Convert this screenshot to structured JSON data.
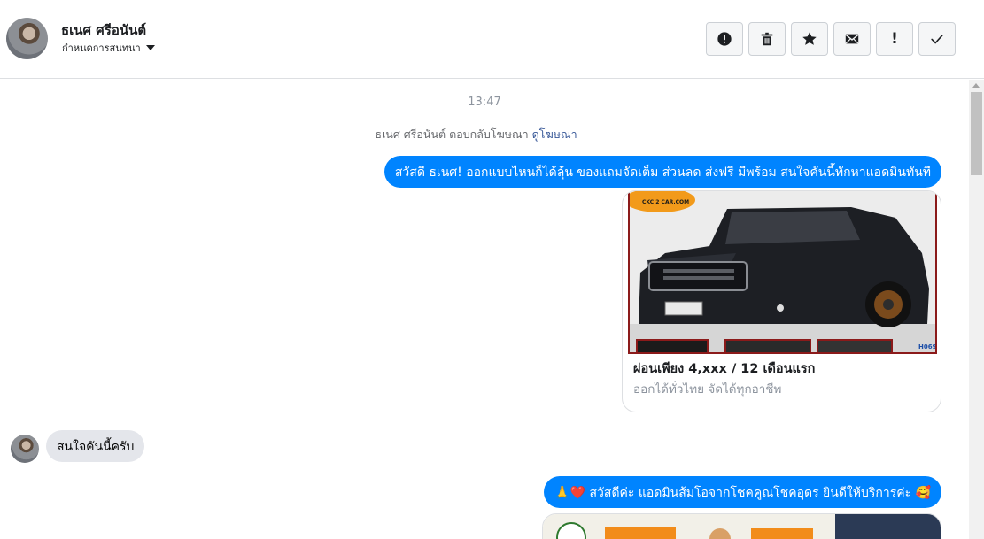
{
  "header": {
    "contact_name": "ธเนศ ศรีอนันต์",
    "assign_label": "กำหนดการสนทนา"
  },
  "toolbar": {
    "buttons": [
      {
        "name": "report-spam",
        "icon": "exclamation-circle-icon"
      },
      {
        "name": "delete",
        "icon": "trash-icon"
      },
      {
        "name": "star",
        "icon": "star-icon"
      },
      {
        "name": "mark-unread",
        "icon": "envelope-icon"
      },
      {
        "name": "follow-up",
        "icon": "exclamation-icon",
        "glyph": "!"
      },
      {
        "name": "mark-done",
        "icon": "check-icon"
      }
    ]
  },
  "thread": {
    "timestamp": "13:47",
    "system_note": "ธเนศ ศรีอนันต์ ตอบกลับโฆษณา",
    "system_link": "ดูโฆษณา",
    "messages": [
      {
        "direction": "out",
        "text": "สวัสดี ธเนศ! ออกแบบไหนก็ได้ลุ้น ของแถมจัดเต็ม ส่วนลด ส่งฟรี มีพร้อม สนใจคันนี้ทักหาแอดมินทันที"
      },
      {
        "direction": "out",
        "type": "ad-card",
        "title": "ผ่อนเพียง 4,xxx / 12 เดือนแรก",
        "subtitle": "ออกได้ทั่วไทย จัดได้ทุกอาชีพ",
        "image_logo_text": "CKC 2 CAR.COM",
        "image_code": "H069"
      },
      {
        "direction": "in",
        "text": "สนใจคันนี้ครับ"
      },
      {
        "direction": "out",
        "text": "🙏❤️ สวัสดีค่ะ แอดมินส้มโอจากโชคคูณโชคอุดร ยินดีให้บริการค่ะ 🥰"
      }
    ]
  },
  "colors": {
    "outgoing_bubble": "#0084ff",
    "incoming_bubble": "#e4e6eb",
    "link": "#385898",
    "timestamp": "#8d949e"
  }
}
